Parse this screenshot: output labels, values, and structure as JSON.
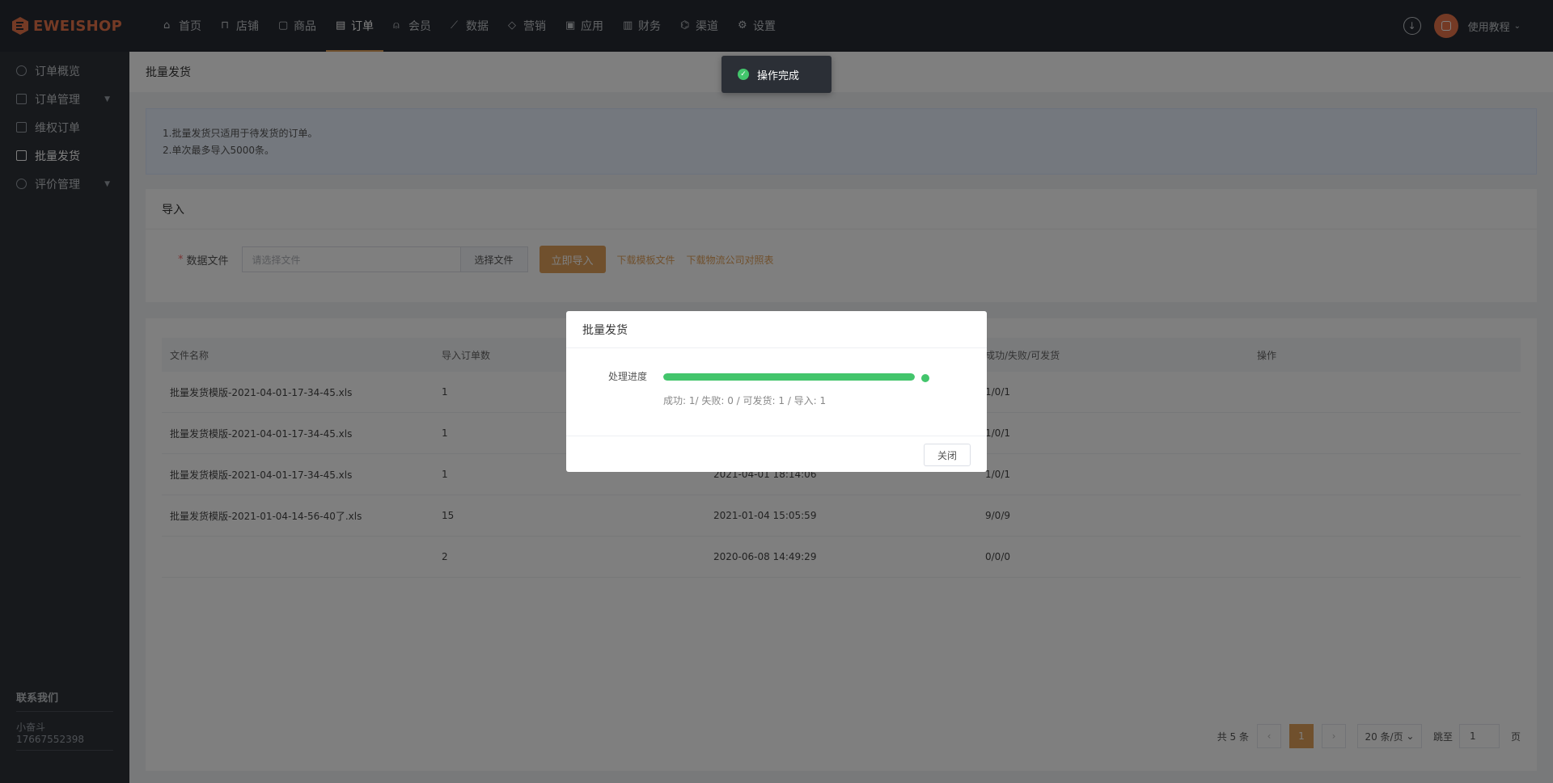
{
  "brand": {
    "name": "EWEISHOP",
    "color": "#e8754a"
  },
  "nav": [
    {
      "label": "首页",
      "icon": "home-icon"
    },
    {
      "label": "店铺",
      "icon": "store-icon"
    },
    {
      "label": "商品",
      "icon": "goods-icon"
    },
    {
      "label": "订单",
      "icon": "order-icon",
      "active": true
    },
    {
      "label": "会员",
      "icon": "user-icon"
    },
    {
      "label": "数据",
      "icon": "chart-icon"
    },
    {
      "label": "营销",
      "icon": "tag-icon"
    },
    {
      "label": "应用",
      "icon": "app-icon"
    },
    {
      "label": "财务",
      "icon": "finance-icon"
    },
    {
      "label": "渠道",
      "icon": "channel-icon"
    },
    {
      "label": "设置",
      "icon": "gear-icon"
    }
  ],
  "header": {
    "tutorial_label": "使用教程"
  },
  "sidebar": {
    "items": [
      {
        "label": "订单概览",
        "icon": "clock-icon"
      },
      {
        "label": "订单管理",
        "icon": "list-icon",
        "has_caret": true
      },
      {
        "label": "维权订单",
        "icon": "grid-icon"
      },
      {
        "label": "批量发货",
        "icon": "batch-icon",
        "active": true
      },
      {
        "label": "评价管理",
        "icon": "comment-icon",
        "has_caret": true
      }
    ],
    "contact": {
      "title": "联系我们",
      "name": "小奋斗",
      "phone": "17667552398"
    }
  },
  "page": {
    "breadcrumb": "批量发货",
    "notice": [
      "1.批量发货只适用于待发货的订单。",
      "2.单次最多导入5000条。"
    ],
    "import": {
      "title": "导入",
      "required_mark": "*",
      "label": "数据文件",
      "placeholder": "请选择文件",
      "choose_button": "选择文件",
      "import_button": "立即导入",
      "download_template": "下载模板文件",
      "download_logistics": "下载物流公司对照表"
    },
    "table": {
      "headers": [
        "文件名称",
        "导入订单数",
        "",
        "成功/失败/可发货",
        "操作"
      ],
      "rows": [
        [
          "批量发货模版-2021-04-01-17-34-45.xls",
          "1",
          "",
          "1/0/1",
          ""
        ],
        [
          "批量发货模版-2021-04-01-17-34-45.xls",
          "1",
          "",
          "1/0/1",
          ""
        ],
        [
          "批量发货模版-2021-04-01-17-34-45.xls",
          "1",
          "2021-04-01 18:14:06",
          "1/0/1",
          ""
        ],
        [
          "批量发货模版-2021-01-04-14-56-40了.xls",
          "15",
          "2021-01-04 15:05:59",
          "9/0/9",
          ""
        ],
        [
          "",
          "2",
          "2020-06-08 14:49:29",
          "0/0/0",
          ""
        ]
      ]
    },
    "pagination": {
      "total": "共 5 条",
      "current": "1",
      "page_size": "20 条/页",
      "jump_label": "跳至",
      "jump_value": "1",
      "unit": "页"
    }
  },
  "toast": {
    "text": "操作完成",
    "color": "#43c56c"
  },
  "modal": {
    "title": "批量发货",
    "progress_label": "处理进度",
    "progress": 1.0,
    "stats": "成功: 1/ 失败: 0 / 可发货: 1 / 导入: 1",
    "close_button": "关闭"
  },
  "colors": {
    "accent": "#e0a15a",
    "success": "#43c56c",
    "topbar": "#262b33",
    "sidebar": "#2e3238"
  }
}
